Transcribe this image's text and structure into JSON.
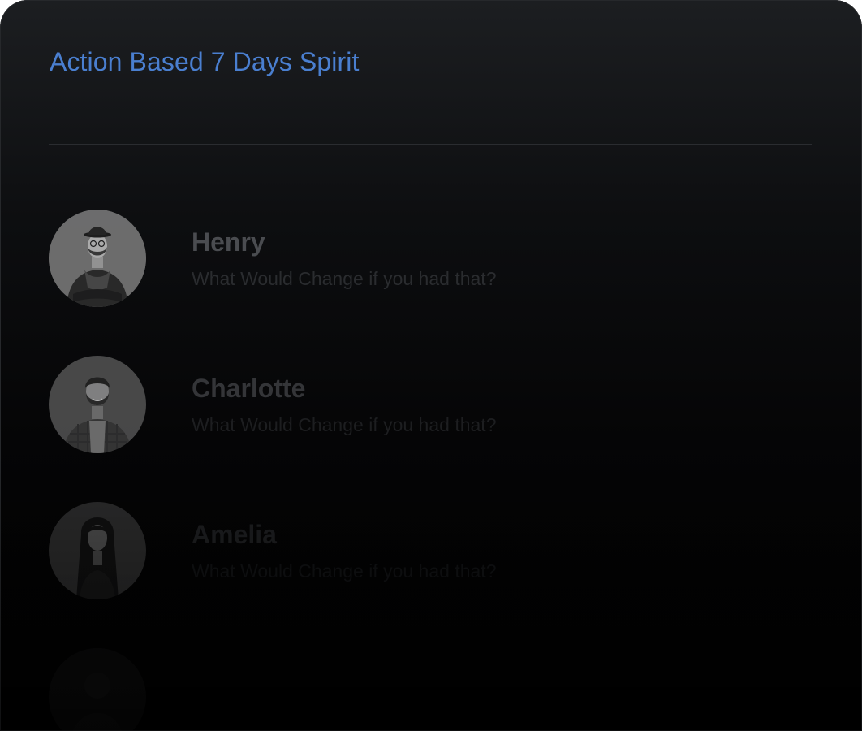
{
  "card": {
    "title": "Action Based 7 Days Spirit"
  },
  "colors": {
    "title": "#4a7fd0",
    "background_top": "#1c1e21",
    "background_bottom": "#000000",
    "divider": "#2a2c30"
  },
  "chats": [
    {
      "name": "Henry",
      "message": "What Would Change if you had that?",
      "avatar": "man-with-hat-avatar"
    },
    {
      "name": "Charlotte",
      "message": "What Would Change if you had that?",
      "avatar": "bearded-man-avatar"
    },
    {
      "name": "Amelia",
      "message": "What Would Change if you had that?",
      "avatar": "long-haired-woman-avatar"
    },
    {
      "name": "",
      "message": "",
      "avatar": "faded-avatar"
    }
  ]
}
